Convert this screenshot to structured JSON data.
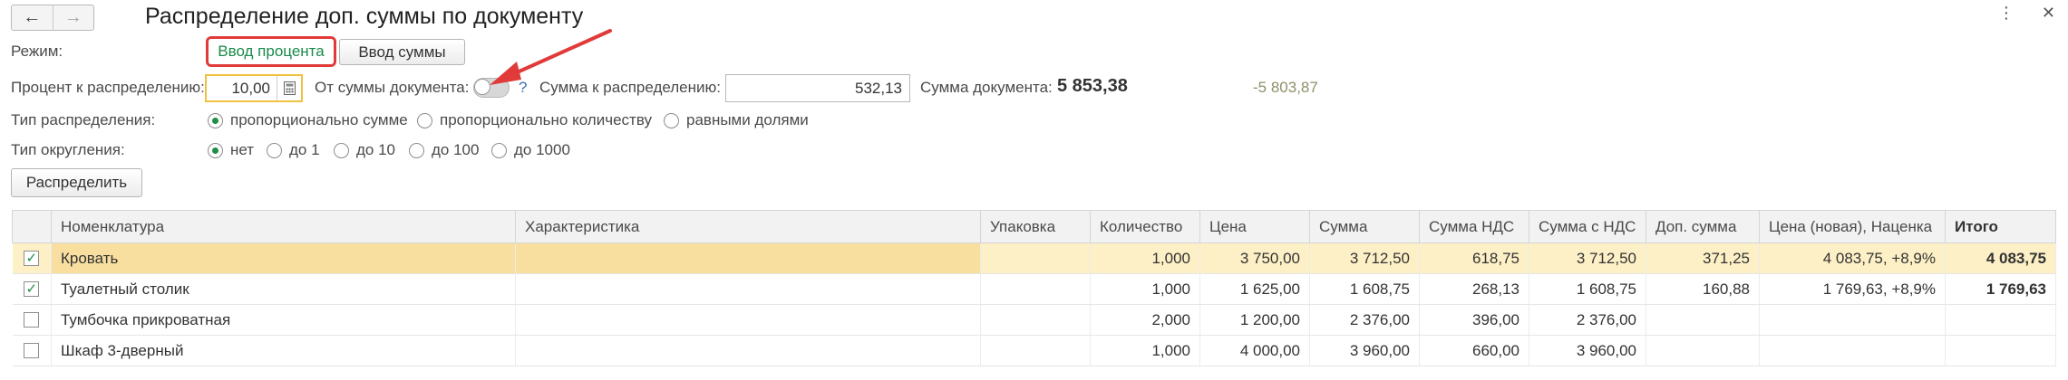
{
  "window": {
    "title": "Распределение доп. суммы по документу",
    "back_icon": "←",
    "forward_icon": "→",
    "menu_icon": "⋮",
    "close_icon": "✕"
  },
  "mode": {
    "label": "Режим:",
    "percent_button": "Ввод процента",
    "sum_button": "Ввод суммы"
  },
  "params": {
    "percent_label": "Процент к распределению:",
    "percent_value": "10,00",
    "from_doc_label": "От суммы документа:",
    "help_mark": "?",
    "sum_label": "Сумма к распределению:",
    "sum_value": "532,13",
    "doc_sum_label": "Сумма документа:",
    "doc_sum_value": "5 853,38",
    "difference": "-5 803,87"
  },
  "distribution": {
    "label": "Тип распределения:",
    "options": [
      "пропорционально сумме",
      "пропорционально количеству",
      "равными долями"
    ],
    "selected": 0
  },
  "rounding": {
    "label": "Тип округления:",
    "options": [
      "нет",
      "до 1",
      "до 10",
      "до 100",
      "до 1000"
    ],
    "selected": 0
  },
  "distribute_button": "Распределить",
  "table": {
    "columns": [
      "Номенклатура",
      "Характеристика",
      "Упаковка",
      "Количество",
      "Цена",
      "Сумма",
      "Сумма НДС",
      "Сумма с НДС",
      "Доп. сумма",
      "Цена (новая), Наценка",
      "Итого"
    ],
    "rows": [
      {
        "checked": true,
        "name": "Кровать",
        "char": "",
        "pack": "",
        "qty": "1,000",
        "price": "3 750,00",
        "sum": "3 712,50",
        "vat": "618,75",
        "sum_vat": "3 712,50",
        "extra": "371,25",
        "new_price": "4 083,75, +8,9%",
        "total": "4 083,75"
      },
      {
        "checked": true,
        "name": "Туалетный столик",
        "char": "",
        "pack": "",
        "qty": "1,000",
        "price": "1 625,00",
        "sum": "1 608,75",
        "vat": "268,13",
        "sum_vat": "1 608,75",
        "extra": "160,88",
        "new_price": "1 769,63, +8,9%",
        "total": "1 769,63"
      },
      {
        "checked": false,
        "name": "Тумбочка прикроватная",
        "char": "",
        "pack": "",
        "qty": "2,000",
        "price": "1 200,00",
        "sum": "2 376,00",
        "vat": "396,00",
        "sum_vat": "2 376,00",
        "extra": "",
        "new_price": "",
        "total": ""
      },
      {
        "checked": false,
        "name": "Шкаф 3-дверный",
        "char": "",
        "pack": "",
        "qty": "1,000",
        "price": "4 000,00",
        "sum": "3 960,00",
        "vat": "660,00",
        "sum_vat": "3 960,00",
        "extra": "",
        "new_price": "",
        "total": ""
      }
    ]
  },
  "colors": {
    "accent_green": "#1a8a4a",
    "highlight_red": "#e03a3a",
    "selected_row": "#fdf0c6"
  }
}
